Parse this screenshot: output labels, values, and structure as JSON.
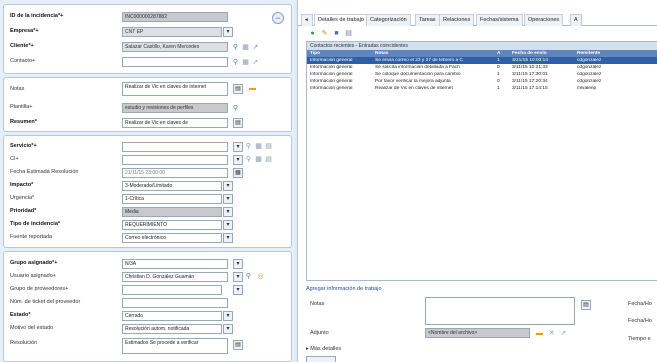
{
  "form": {
    "group1": {
      "id_label": "ID de la incidencia*+",
      "id_value": "INC000000287882",
      "empresa_label": "Empresa*+",
      "empresa_value": "CNT EP",
      "cliente_label": "Cliente*+",
      "cliente_value": "Salazar Castillo, Karen Mercedes",
      "contacto_label": "Contacto+",
      "contacto_value": ""
    },
    "group2": {
      "notas_label": "Notas",
      "notas_value": "Realizar de Vic en claves de internet",
      "plantilla_label": "Plantilla+",
      "plantilla_value": "estudio y revisiones de perfiles",
      "resumen_label": "Resumen*",
      "resumen_value": "Realizar de Vic en claves de"
    },
    "group3": {
      "servicio_label": "Servicio*+",
      "servicio_value": "",
      "ci_label": "CI+",
      "ci_value": "",
      "fecha_label": "Fecha Estimada Resolución",
      "fecha_value": "21/11/15 23:00:00",
      "impacto_label": "Impacto*",
      "impacto_value": "3-Moderado/Limitado",
      "urgencia_label": "Urgencia*",
      "urgencia_value": "1-Crítica",
      "prioridad_label": "Prioridad*",
      "prioridad_value": "Media",
      "tipo_label": "Tipo de incidencia*",
      "tipo_value": "REQUERIMIENTO",
      "fuente_label": "Fuente reportada",
      "fuente_value": "Correo electrónico"
    },
    "group4": {
      "grupo_label": "Grupo asignado*+",
      "grupo_value": "N/3A",
      "usuario_label": "Usuario asignado+",
      "usuario_value": "Christian D. González Guamán",
      "grupo_prov_label": "Grupo de proveedores+",
      "grupo_prov_value": "",
      "num_ticket_label": "Núm. de ticket del proveedor",
      "num_ticket_value": "",
      "estado_label": "Estado*",
      "estado_value": "Cerrado",
      "motivo_label": "Motivo del estado",
      "motivo_value": "Resolución autom. notificada",
      "resolucion_label": "Resolución",
      "resolucion_value": "Estimados Se procede a verificar"
    }
  },
  "tabs": [
    {
      "label": "Detalles de trabajo"
    },
    {
      "label": "Categorización"
    },
    {
      "label": "Tareas"
    },
    {
      "label": "Relaciones"
    },
    {
      "label": "Fechas/sistema"
    },
    {
      "label": "Operaciones"
    },
    {
      "label": "A"
    }
  ],
  "grid": {
    "title": "Contactos recientes - Entradas coincidentes",
    "columns": [
      "Tipo",
      "Notas",
      "A",
      "Fecha de envío",
      "Remitente"
    ],
    "rows": [
      {
        "tipo": "Información general",
        "notas": "Se envía correo el 23 y 27 de febrero a C",
        "a": "1",
        "fecha": "3/21/15 10:03:14",
        "rem": "cdgonzalez",
        "selected": true
      },
      {
        "tipo": "Información general",
        "notas": "Se solicita información detallada a Fach",
        "a": "0",
        "fecha": "3/11/15 10:21:33",
        "rem": "cdgonzalez",
        "selected": false
      },
      {
        "tipo": "Información general",
        "notas": "Se coloque documentación para cambio",
        "a": "1",
        "fecha": "3/11/15 17:30:01",
        "rem": "cdgonzalez",
        "selected": false
      },
      {
        "tipo": "Información general",
        "notas": "Por favor verificar la mejora adjunta",
        "a": "0",
        "fecha": "3/11/15 17:20:34",
        "rem": "cdgonzalez",
        "selected": false
      },
      {
        "tipo": "Información general",
        "notas": "Realizar de Vic en claves de internet",
        "a": "1",
        "fecha": "3/11/15 17:14:15",
        "rem": "mlvalenp",
        "selected": false
      }
    ]
  },
  "worknote": {
    "title": "Agregar información de trabajo",
    "notas_label": "Notas",
    "adjunto_label": "Adjunto",
    "adjunto_value": "<Nombre del archivo>",
    "mas_detalles": "Más detalles",
    "fecha1": "Fecha/Ho",
    "fecha2": "Fecha/Ho",
    "tiempo": "Tiempo e"
  }
}
